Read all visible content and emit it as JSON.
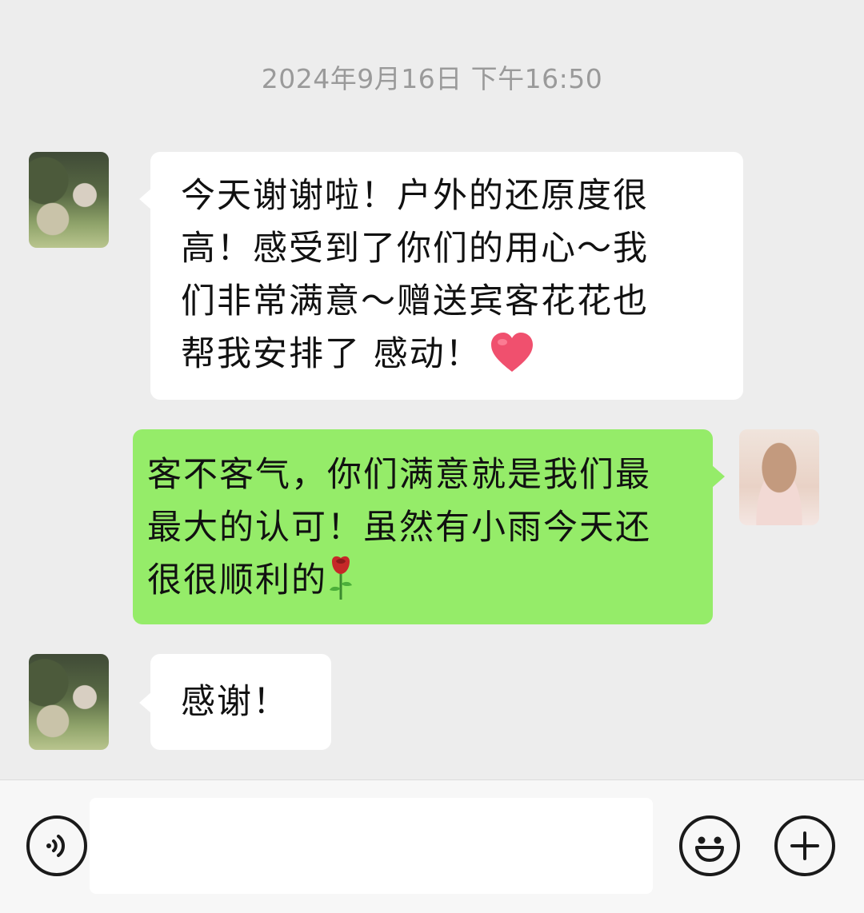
{
  "timestamp": "2024年9月16日 下午16:50",
  "messages": [
    {
      "side": "left",
      "lines": [
        "今天谢谢啦！户外的还原度很",
        "高！感受到了你们的用心～我",
        "们非常满意～赠送宾客花花也",
        "帮我安排了  感动！"
      ],
      "emoji": "heart"
    },
    {
      "side": "right",
      "lines": [
        "客不客气，你们满意就是我们最",
        "最大的认可！虽然有小雨今天还",
        "很很顺利的"
      ],
      "emoji": "rose"
    },
    {
      "side": "left",
      "lines": [
        "感谢！"
      ]
    }
  ],
  "input": {
    "value": "",
    "placeholder": ""
  },
  "icons": {
    "voice": "voice-icon",
    "emoji": "emoji-icon",
    "plus": "plus-icon"
  },
  "colors": {
    "background": "#ededed",
    "bubble_left": "#ffffff",
    "bubble_right": "#95ec69",
    "timestamp": "#9a9a9a",
    "heart": "#f0506e",
    "rose": "#c62828"
  }
}
